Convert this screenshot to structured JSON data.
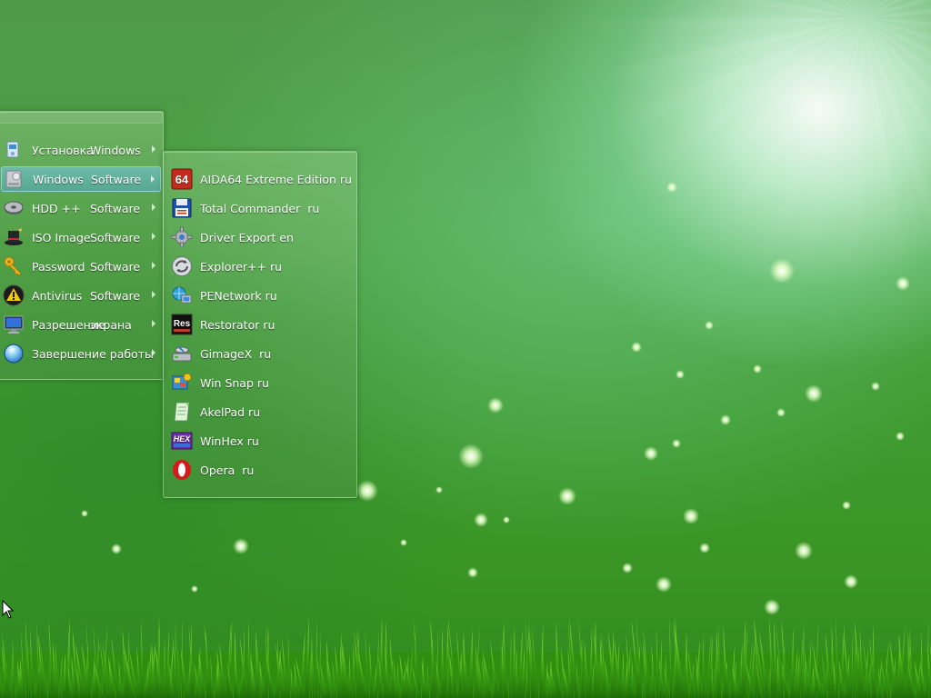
{
  "main_menu": {
    "items": [
      {
        "w1": "Установка",
        "w2": "Windows",
        "icon": "installer-icon",
        "has_submenu": true,
        "selected": false
      },
      {
        "w1": "Windows",
        "w2": "Software",
        "icon": "drive-software-icon",
        "has_submenu": true,
        "selected": true
      },
      {
        "w1": "HDD ++",
        "w2": "Software",
        "icon": "hard-disk-icon",
        "has_submenu": true,
        "selected": false
      },
      {
        "w1": "ISO Image",
        "w2": "Software",
        "icon": "magic-hat-icon",
        "has_submenu": true,
        "selected": false
      },
      {
        "w1": "Password",
        "w2": "Software",
        "icon": "key-icon",
        "has_submenu": true,
        "selected": false
      },
      {
        "w1": "Antivirus",
        "w2": "Software",
        "icon": "warning-shield-icon",
        "has_submenu": true,
        "selected": false
      },
      {
        "w1": "Разрешение",
        "w2": "экрана",
        "icon": "monitor-icon",
        "has_submenu": true,
        "selected": false
      },
      {
        "w1": "Завершение работы",
        "w2": "",
        "icon": "shutdown-orb-icon",
        "has_submenu": true,
        "selected": false
      }
    ]
  },
  "sub_menu": {
    "items": [
      {
        "label": "AIDA64 Extreme Edition ru",
        "icon": "aida64-icon",
        "icon_text": "64"
      },
      {
        "label": "Total Commander  ru",
        "icon": "floppy-disk-icon"
      },
      {
        "label": "Driver Export en",
        "icon": "gear-icon"
      },
      {
        "label": "Explorer++ ru",
        "icon": "refresh-arrows-icon"
      },
      {
        "label": "PENetwork ru",
        "icon": "network-icon"
      },
      {
        "label": "Restorator ru",
        "icon": "restorator-icon",
        "icon_text": "Res"
      },
      {
        "label": "GimageX  ru",
        "icon": "imaging-drive-icon"
      },
      {
        "label": "Win Snap ru",
        "icon": "snapshot-icon"
      },
      {
        "label": "AkelPad ru",
        "icon": "notepad-icon"
      },
      {
        "label": "WinHex ru",
        "icon": "winhex-icon",
        "icon_text": "HEX"
      },
      {
        "label": "Opera  ru",
        "icon": "opera-icon"
      }
    ]
  },
  "colors": {
    "selection": "#6fc0e6",
    "menu_text": "#ffffff"
  }
}
